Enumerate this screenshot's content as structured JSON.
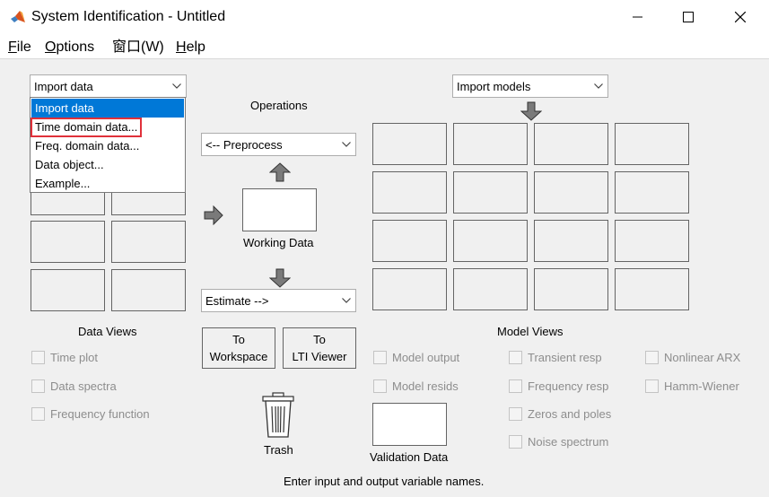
{
  "window": {
    "title": "System Identification - Untitled",
    "icon": "matlab-logo-icon"
  },
  "menu": [
    {
      "first": "F",
      "rest": "ile"
    },
    {
      "first": "O",
      "rest": "ptions"
    },
    {
      "text": "窗口(W)"
    },
    {
      "first": "H",
      "rest": "elp"
    }
  ],
  "import_data": {
    "selected": "Import data",
    "options": [
      "Import data",
      "Time domain data...",
      "Freq. domain data...",
      "Data object...",
      "Example..."
    ],
    "highlighted_option": "Time domain data..."
  },
  "import_models": {
    "selected": "Import models"
  },
  "operations": {
    "title": "Operations",
    "preprocess": "<-- Preprocess",
    "working_data": "Working Data",
    "estimate": "Estimate -->"
  },
  "buttons": {
    "to_workspace_l1": "To",
    "to_workspace_l2": "Workspace",
    "to_lti_l1": "To",
    "to_lti_l2": "LTI Viewer"
  },
  "data_views": {
    "title": "Data Views",
    "items": [
      "Time plot",
      "Data spectra",
      "Frequency function"
    ]
  },
  "model_views": {
    "title": "Model Views",
    "col1": [
      "Model output",
      "Model resids"
    ],
    "col2": [
      "Transient resp",
      "Frequency resp",
      "Zeros and poles",
      "Noise spectrum"
    ],
    "col3": [
      "Nonlinear ARX",
      "Hamm-Wiener"
    ]
  },
  "trash_label": "Trash",
  "validation_data": "Validation Data",
  "status": "Enter input and output variable names.",
  "colors": {
    "accent": "#0078d7",
    "highlight_border": "#e0313a",
    "disabled_text": "#8d8d8d"
  }
}
